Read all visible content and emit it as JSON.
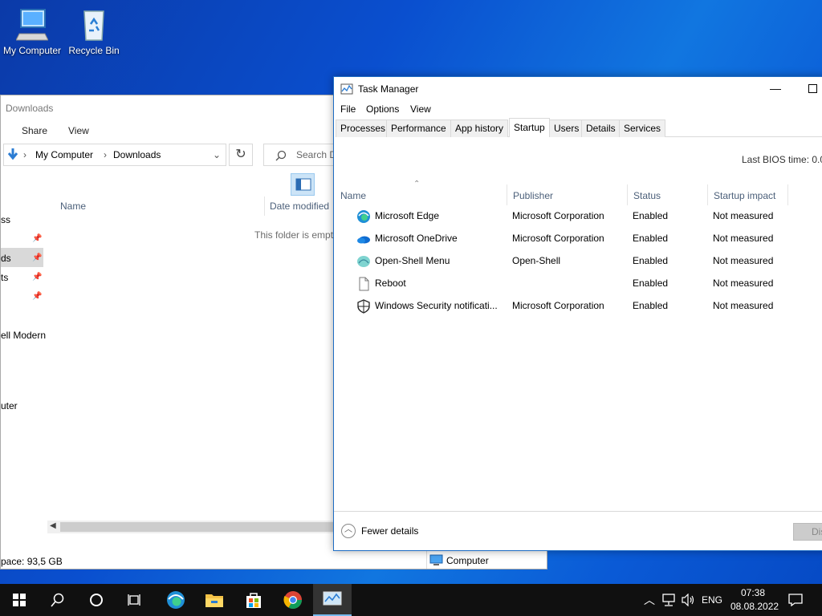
{
  "desktop": {
    "icons": [
      {
        "label": "My Computer"
      },
      {
        "label": "Recycle Bin"
      }
    ]
  },
  "explorer": {
    "title": "Downloads",
    "ribbon_tabs": [
      "Share",
      "View"
    ],
    "address": {
      "root": "My Computer",
      "current": "Downloads"
    },
    "search_placeholder": "Search Downloads",
    "columns": {
      "name": "Name",
      "date_modified": "Date modified"
    },
    "nav_items": [
      "ss",
      "ds",
      "ts",
      "ell Modern",
      "uter"
    ],
    "empty_message": "This folder is empty.",
    "status": {
      "free_space": "pace: 93,5 GB",
      "computer": "Computer"
    }
  },
  "task_manager": {
    "title": "Task Manager",
    "menu": [
      "File",
      "Options",
      "View"
    ],
    "tabs": [
      "Processes",
      "Performance",
      "App history",
      "Startup",
      "Users",
      "Details",
      "Services"
    ],
    "active_tab": "Startup",
    "last_bios_label": "Last BIOS time:",
    "last_bios_value": "0.0",
    "columns": [
      "Name",
      "Publisher",
      "Status",
      "Startup impact"
    ],
    "rows": [
      {
        "icon": "edge-icon",
        "name": "Microsoft Edge",
        "publisher": "Microsoft Corporation",
        "status": "Enabled",
        "impact": "Not measured"
      },
      {
        "icon": "onedrive-icon",
        "name": "Microsoft OneDrive",
        "publisher": "Microsoft Corporation",
        "status": "Enabled",
        "impact": "Not measured"
      },
      {
        "icon": "open-shell-icon",
        "name": "Open-Shell Menu",
        "publisher": "Open-Shell",
        "status": "Enabled",
        "impact": "Not measured"
      },
      {
        "icon": "file-icon",
        "name": "Reboot",
        "publisher": "",
        "status": "Enabled",
        "impact": "Not measured"
      },
      {
        "icon": "shield-icon",
        "name": "Windows Security notificati...",
        "publisher": "Microsoft Corporation",
        "status": "Enabled",
        "impact": "Not measured"
      }
    ],
    "footer": {
      "fewer_details": "Fewer details",
      "disable_button": "Dis"
    }
  },
  "taskbar": {
    "language": "ENG",
    "time": "07:38",
    "date": "08.08.2022"
  },
  "colors": {
    "accent": "#0078d7",
    "desktop": "#0a5ad6",
    "taskbar": "#101010"
  }
}
